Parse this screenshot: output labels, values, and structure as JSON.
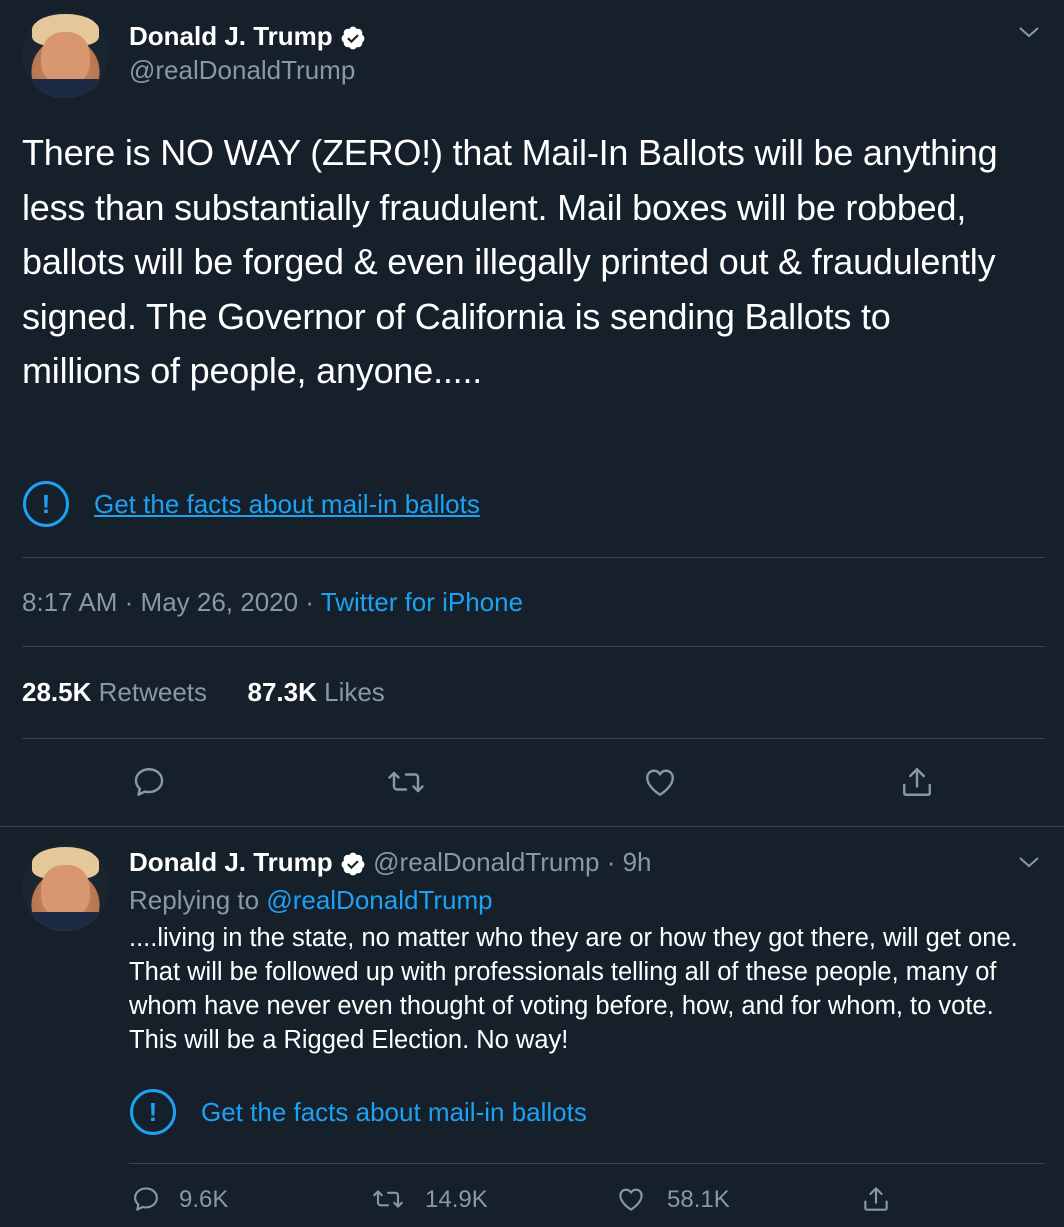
{
  "tweet": {
    "author_name": "Donald J. Trump",
    "author_handle": "@realDonaldTrump",
    "text": "There is NO WAY (ZERO!) that Mail-In Ballots will be anything less than substantially fraudulent. Mail boxes will be robbed, ballots will be forged & even illegally printed out & fraudulently signed. The Governor of California is sending Ballots to millions of people, anyone.....",
    "fact_check": "Get the facts about mail-in ballots",
    "time": "8:17 AM",
    "date": "May 26, 2020",
    "source": "Twitter for iPhone",
    "separator": "·",
    "retweets_count": "28.5K",
    "retweets_label": "Retweets",
    "likes_count": "87.3K",
    "likes_label": "Likes"
  },
  "reply": {
    "author_name": "Donald J. Trump",
    "author_handle": "@realDonaldTrump",
    "age": "· 9h",
    "replying_prefix": "Replying to",
    "replying_handle": "@realDonaldTrump",
    "text": "....living in the state, no matter who they are or how they got there, will get one. That will be followed up with professionals telling all of these people, many of whom have never even thought of voting before, how, and for whom, to vote. This will be a Rigged Election. No way!",
    "fact_check": "Get the facts about mail-in ballots",
    "reply_count": "9.6K",
    "retweet_count": "14.9K",
    "like_count": "58.1K"
  },
  "icons": {
    "verified": "verified-badge-icon",
    "chevron": "chevron-down-icon",
    "alert": "exclamation-circle-icon",
    "reply": "comment-icon",
    "retweet": "retweet-icon",
    "like": "heart-icon",
    "share": "share-icon"
  },
  "colors": {
    "background": "#15202b",
    "accent": "#1da1f2",
    "secondary_text": "#8899a6",
    "divider": "#38444d"
  }
}
